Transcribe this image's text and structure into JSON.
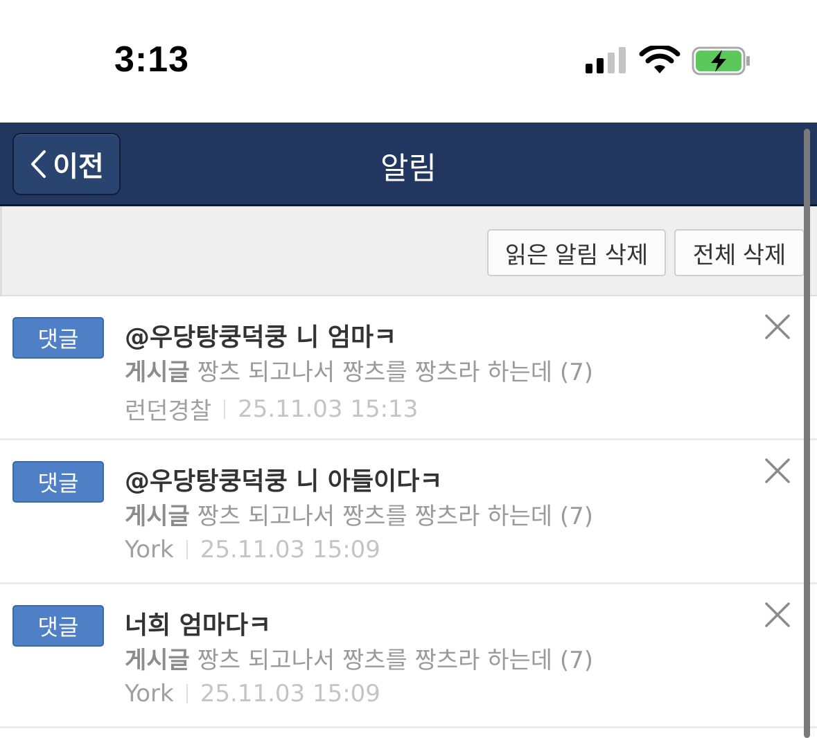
{
  "status_bar": {
    "time": "3:13",
    "icons": [
      "signal-icon",
      "wifi-icon",
      "battery-charging-icon"
    ],
    "battery_color": "#5ac85a"
  },
  "header": {
    "back_label": "이전",
    "title": "알림",
    "background": "#213760"
  },
  "actions": {
    "delete_read_label": "읽은 알림 삭제",
    "delete_all_label": "전체 삭제"
  },
  "notifications": [
    {
      "type": "댓글",
      "title": "@우당탕쿵덕쿵 니 엄마ㅋ",
      "post_label": "게시글",
      "post_title": "짱츠 되고나서 짱츠를 짱츠라 하는데 (7)",
      "author": "런던경찰",
      "date": "25.11.03 15:13"
    },
    {
      "type": "댓글",
      "title": "@우당탕쿵덕쿵 니 아들이다ㅋ",
      "post_label": "게시글",
      "post_title": "짱츠 되고나서 짱츠를 짱츠라 하는데 (7)",
      "author": "York",
      "date": "25.11.03 15:09"
    },
    {
      "type": "댓글",
      "title": "너희 엄마다ㅋ",
      "post_label": "게시글",
      "post_title": "짱츠 되고나서 짱츠를 짱츠라 하는데 (7)",
      "author": "York",
      "date": "25.11.03 15:09"
    }
  ],
  "badge_color": "#4f80c6"
}
